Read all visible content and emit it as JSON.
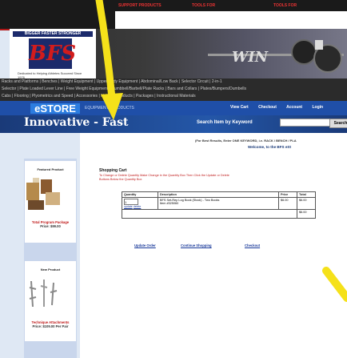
{
  "topnav": {
    "tabs": [
      {
        "sup": "SUPPORT PRODUCTS",
        "label": "STORE"
      },
      {
        "sup": "TOOLS FOR",
        "label": "COACHES"
      },
      {
        "sup": "TOOLS FOR",
        "label": "ATHLETES"
      }
    ]
  },
  "logo": {
    "tagline": "BIGGER FASTER STRONGER",
    "mark": "BFS",
    "subtitle": "Dedicated to Helping Athletes Succeed Since 1976"
  },
  "categories": {
    "line1": "Racks and Platforms | Benches | Weight Equipment | Upper Body Equipment | Abdominal/Low Back | Selector Circuit | 2-in-1",
    "line2": "Selector | Plate Loaded Lever Line | Free Weight Equipment | Dumbbell/Barbell/Plate Racks | Bars and Collars | Plates/Bumpers/Dumbells",
    "line3": "Cabs | Flooring | Plyometrics and Speed | Accessories | Nutrition Products | Packages | Instructional Materials"
  },
  "estore": {
    "logo": "eSTORE",
    "subtitle": "EQUIPMENT / PRODUCTS",
    "links": [
      "View Cart",
      "Checkout",
      "Account",
      "Login"
    ]
  },
  "banner": {
    "slogan": "Innovative - Fast",
    "search_label": "Search Item by Keyword",
    "search_value": "",
    "search_button": "Search"
  },
  "main": {
    "search_hint": "(For Best Results, Enter ONE KEYWORD, i.e. RACK / BENCH / PLA",
    "welcome": "Welcome, to the BFS eSt",
    "cart_title": "Shopping Cart",
    "cart_instruction": "To Change or Delete Quantity Make Change in the Quantity Box Then Click the Update or Delete Buttons Below the Quantity Box",
    "table_headers": [
      "Quantity",
      "Description",
      "Price",
      "Total"
    ],
    "row": {
      "quantity": "1",
      "update_link": "update",
      "delete_link": "delete",
      "description": "BFS Set-Rep Log Book (Stock) - Two Books",
      "item_no": "Item #325060",
      "price": "$6.00",
      "total": "$6.00"
    },
    "grand_total": "$6.00",
    "actions": [
      "Update Order",
      "Continue Shopping",
      "Checkout"
    ]
  },
  "sidebar": {
    "featured": {
      "title": "Featured Product",
      "name": "Total Program Package",
      "price": "Price: $99.00"
    },
    "new": {
      "title": "New Product",
      "name": "Technique Attachments",
      "price": "Price: $109.00 Per Pair"
    }
  },
  "colors": {
    "accent_blue": "#1f4fa8",
    "brand_red": "#c01b1b",
    "arrow_yellow": "#f5e11a"
  }
}
